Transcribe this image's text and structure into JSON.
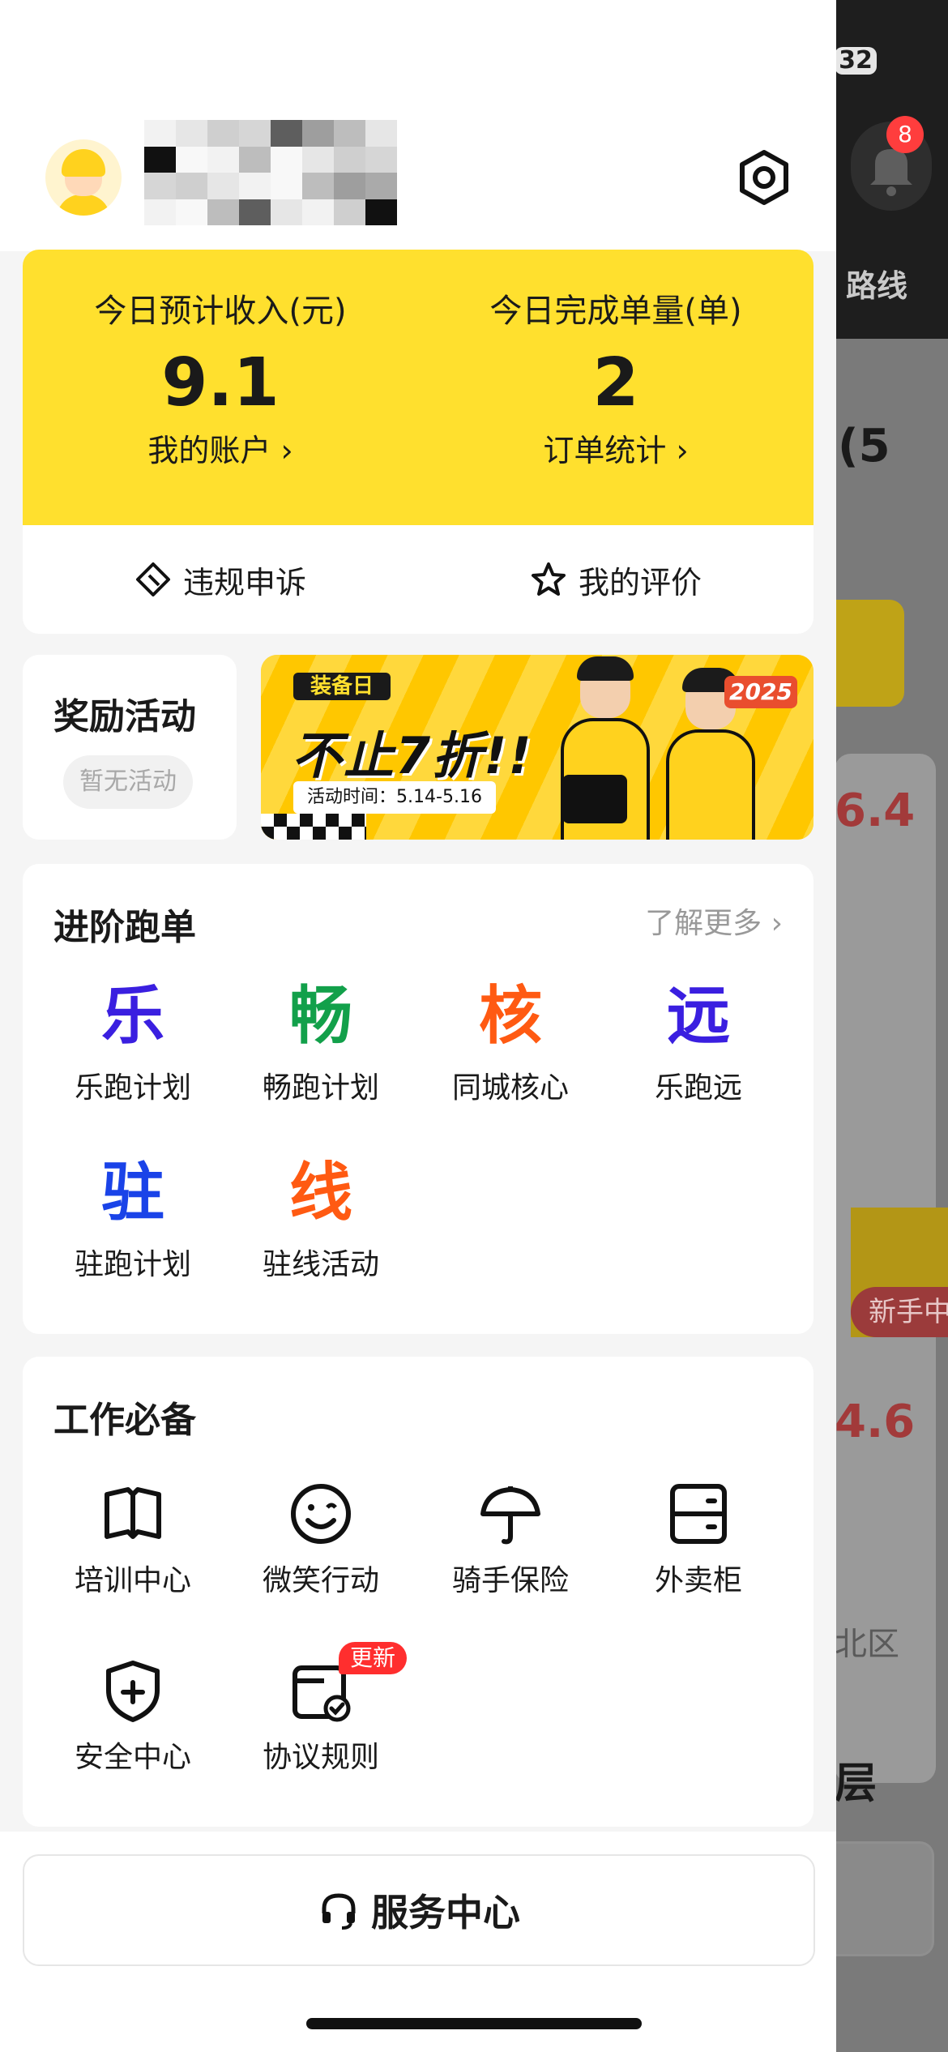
{
  "background_app": {
    "battery": "32",
    "notification_count": "8",
    "route_label": "路线",
    "title_fragment": "(5",
    "value_1": "6.4",
    "new_tag": "新手中",
    "value_2": "4.6",
    "district_fragment": "北区",
    "layer_fragment": "层"
  },
  "header": {
    "avatar": "rider-avatar",
    "username": "",
    "settings_icon": "settings-icon"
  },
  "earnings": {
    "income_label": "今日预计收入(元)",
    "income_value": "9.1",
    "account_link": "我的账户 ›",
    "orders_label": "今日完成单量(单)",
    "orders_value": "2",
    "orders_link": "订单统计 ›",
    "appeal_label": "违规申诉",
    "review_label": "我的评价"
  },
  "reward": {
    "title": "奖励活动",
    "status": "暂无活动"
  },
  "banner": {
    "logo_text": "装备日",
    "headline": "不止7折!!",
    "date_text": "活动时间：5.14-5.16",
    "year": "2025"
  },
  "advanced": {
    "title": "进阶跑单",
    "more": "了解更多 ›",
    "items": [
      {
        "glyph": "乐",
        "label": "乐跑计划",
        "color": "#3a1fe0"
      },
      {
        "glyph": "畅",
        "label": "畅跑计划",
        "color": "#12a04a"
      },
      {
        "glyph": "核",
        "label": "同城核心",
        "color": "#ff5a12"
      },
      {
        "glyph": "远",
        "label": "乐跑远",
        "color": "#3a1fe0"
      },
      {
        "glyph": "驻",
        "label": "驻跑计划",
        "color": "#1a43e8"
      },
      {
        "glyph": "线",
        "label": "驻线活动",
        "color": "#ff5a12"
      }
    ]
  },
  "tools": {
    "title": "工作必备",
    "items": [
      {
        "label": "培训中心",
        "icon": "book-icon"
      },
      {
        "label": "微笑行动",
        "icon": "smile-icon"
      },
      {
        "label": "骑手保险",
        "icon": "umbrella-icon"
      },
      {
        "label": "外卖柜",
        "icon": "locker-icon"
      },
      {
        "label": "安全中心",
        "icon": "shield-icon"
      },
      {
        "label": "协议规则",
        "icon": "agreement-icon",
        "badge": "更新"
      }
    ]
  },
  "service": {
    "label": "服务中心"
  }
}
